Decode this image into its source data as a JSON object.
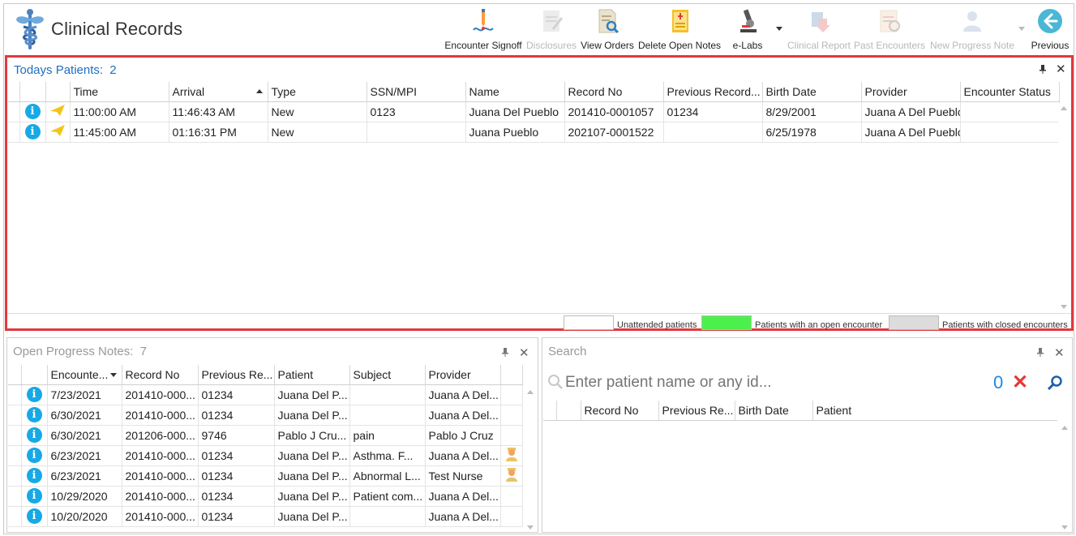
{
  "app": {
    "title": "Clinical Records"
  },
  "toolbar": {
    "buttons": [
      {
        "label": "Encounter Signoff",
        "icon": "pen-signoff-icon",
        "enabled": true
      },
      {
        "label": "Disclosures",
        "icon": "document-edit-icon",
        "enabled": false
      },
      {
        "label": "View Orders",
        "icon": "document-search-icon",
        "enabled": true
      },
      {
        "label": "Delete Open Notes",
        "icon": "note-delete-icon",
        "enabled": true
      },
      {
        "label": "e-Labs",
        "icon": "microscope-icon",
        "enabled": true
      },
      {
        "label": "Clinical Report",
        "icon": "report-download-icon",
        "enabled": false
      },
      {
        "label": "Past Encounters",
        "icon": "past-encounters-icon",
        "enabled": false
      },
      {
        "label": "New Progress Note",
        "icon": "person-note-icon",
        "enabled": false
      },
      {
        "label": "Previous",
        "icon": "arrow-left-circle-icon",
        "enabled": true
      }
    ]
  },
  "todays_patients": {
    "title": "Todays Patients:",
    "count": "2",
    "columns": [
      "Time",
      "Arrival",
      "Type",
      "SSN/MPI",
      "Name",
      "Record No",
      "Previous Record...",
      "Birth Date",
      "Provider",
      "Encounter Status"
    ],
    "rows": [
      {
        "time": "11:00:00 AM",
        "arrival": "11:46:43 AM",
        "type": "New",
        "ssn": "0123",
        "name": "Juana Del Pueblo",
        "record_no": "201410-0001057",
        "prev_record": "01234",
        "birth_date": "8/29/2001",
        "provider": "Juana A Del Pueblo",
        "status": ""
      },
      {
        "time": "11:45:00 AM",
        "arrival": "01:16:31 PM",
        "type": "New",
        "ssn": "",
        "name": "Juana Pueblo",
        "record_no": "202107-0001522",
        "prev_record": "",
        "birth_date": "6/25/1978",
        "provider": "Juana A Del Pueblo",
        "status": ""
      }
    ],
    "legend": [
      {
        "label": "Unattended patients",
        "color": "#ffffff"
      },
      {
        "label": "Patients with an open encounter",
        "color": "#4cf04c"
      },
      {
        "label": "Patients with closed encounters",
        "color": "#dcdcdc"
      }
    ]
  },
  "progress_notes": {
    "title": "Open Progress Notes:",
    "count": "7",
    "columns": [
      "Encounte...",
      "Record No",
      "Previous Re...",
      "Patient",
      "Subject",
      "Provider"
    ],
    "rows": [
      {
        "date": "7/23/2021",
        "record_no": "201410-000...",
        "prev": "01234",
        "patient": "Juana Del P...",
        "subject": "",
        "provider": "Juana A Del...",
        "flag": false
      },
      {
        "date": "6/30/2021",
        "record_no": "201410-000...",
        "prev": "01234",
        "patient": "Juana Del P...",
        "subject": "",
        "provider": "Juana A Del...",
        "flag": false
      },
      {
        "date": "6/30/2021",
        "record_no": "201206-000...",
        "prev": "9746",
        "patient": "Pablo J Cru...",
        "subject": "pain",
        "provider": "Pablo J Cruz",
        "flag": false
      },
      {
        "date": "6/23/2021",
        "record_no": "201410-000...",
        "prev": "01234",
        "patient": "Juana Del P...",
        "subject": "Asthma.   F...",
        "provider": "Juana A Del...",
        "flag": true
      },
      {
        "date": "6/23/2021",
        "record_no": "201410-000...",
        "prev": "01234",
        "patient": "Juana Del P...",
        "subject": "Abnormal L...",
        "provider": "Test Nurse",
        "flag": true
      },
      {
        "date": "10/29/2020",
        "record_no": "201410-000...",
        "prev": "01234",
        "patient": "Juana Del P...",
        "subject": "Patient com...",
        "provider": "Juana A Del...",
        "flag": false
      },
      {
        "date": "10/20/2020",
        "record_no": "201410-000...",
        "prev": "01234",
        "patient": "Juana Del P...",
        "subject": "",
        "provider": "Juana A Del...",
        "flag": false
      }
    ]
  },
  "search": {
    "title": "Search",
    "placeholder": "Enter patient name or any id...",
    "result_count": "0",
    "columns": [
      "Record No",
      "Previous Re...",
      "Birth Date",
      "Patient"
    ]
  },
  "colors": {
    "accent": "#1e6fc0",
    "highlight_border": "#e0393e",
    "info": "#16a9e6",
    "clear": "#e53935"
  }
}
